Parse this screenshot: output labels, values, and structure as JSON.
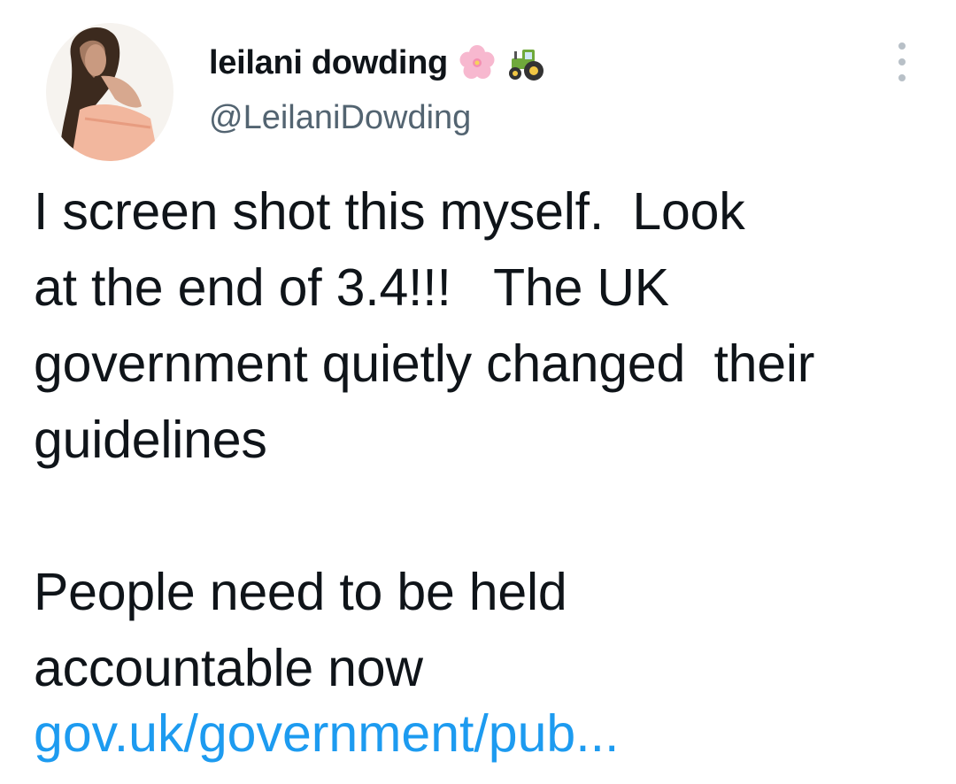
{
  "author": {
    "display_name": "leilani dowding",
    "handle": "@LeilaniDowding",
    "name_emojis": [
      "cherry-blossom-emoji",
      "tractor-emoji"
    ],
    "avatar_icon": "profile-photo"
  },
  "menu": {
    "icon": "more-options-icon"
  },
  "tweet": {
    "lines": [
      "I screen shot this myself.  Look",
      "at the end of 3.4!!!   The UK",
      "government quietly changed  their",
      "guidelines",
      "",
      "People need to be held",
      "accountable now"
    ],
    "link_text": "gov.uk/government/pub..."
  },
  "colors": {
    "text": "#0f1419",
    "secondary": "#536471",
    "link": "#1d9bf0",
    "menu_dots": "#b8c0c7"
  }
}
